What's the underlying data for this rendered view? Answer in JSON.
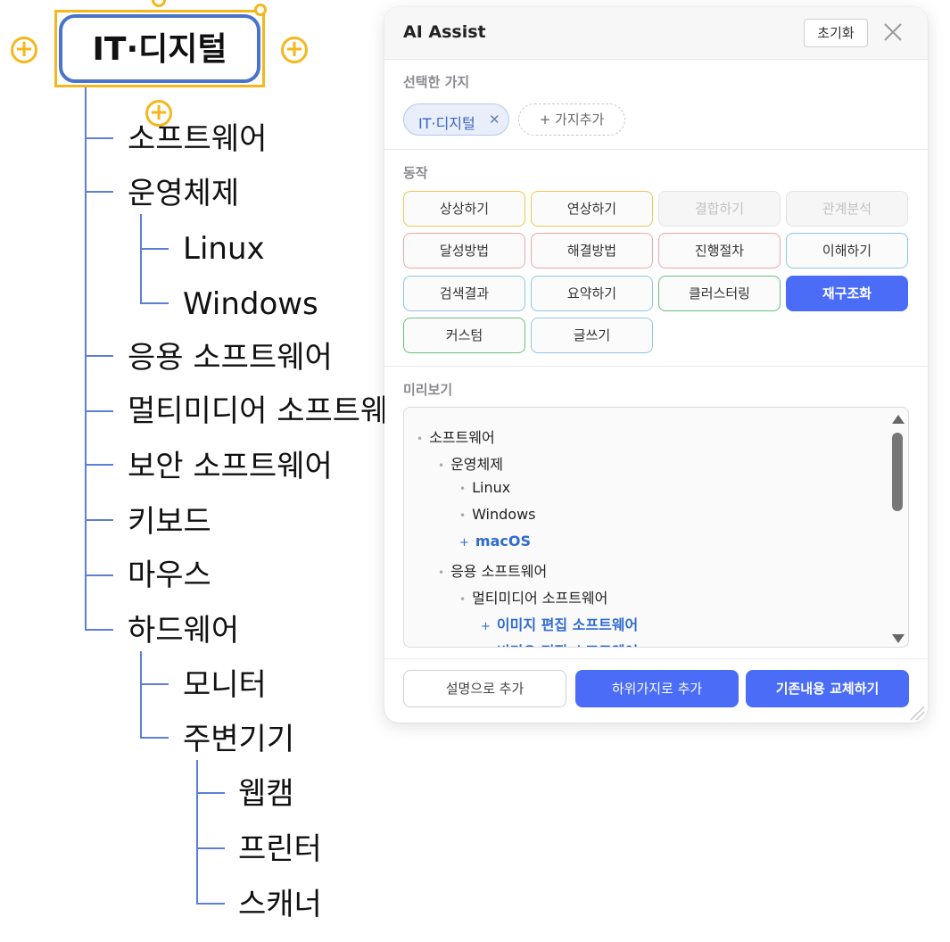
{
  "mindmap": {
    "root": "IT·디지털",
    "nodes": [
      "소프트웨어",
      "운영체제",
      "Linux",
      "Windows",
      "응용 소프트웨어",
      "멀티미디어 소프트웨어",
      "보안 소프트웨어",
      "키보드",
      "마우스",
      "하드웨어",
      "모니터",
      "주변기기",
      "웹캠",
      "프린터",
      "스캐너"
    ]
  },
  "panel": {
    "title": "AI Assist",
    "reset_label": "초기화",
    "selected_section": "선택한 가지",
    "selected_chip": "IT·디지털",
    "add_branch": "+ 가지추가",
    "action_section": "동작",
    "actions": [
      {
        "label": "상상하기",
        "state": "normal",
        "color": "yellow"
      },
      {
        "label": "연상하기",
        "state": "normal",
        "color": "yellow"
      },
      {
        "label": "결합하기",
        "state": "disabled",
        "color": "gray"
      },
      {
        "label": "관계분석",
        "state": "disabled",
        "color": "gray"
      },
      {
        "label": "달성방법",
        "state": "normal",
        "color": "red"
      },
      {
        "label": "해결방법",
        "state": "normal",
        "color": "red"
      },
      {
        "label": "진행절차",
        "state": "normal",
        "color": "red"
      },
      {
        "label": "이해하기",
        "state": "normal",
        "color": "blue"
      },
      {
        "label": "검색결과",
        "state": "normal",
        "color": "blue"
      },
      {
        "label": "요약하기",
        "state": "normal",
        "color": "blue"
      },
      {
        "label": "클러스터링",
        "state": "normal",
        "color": "green"
      },
      {
        "label": "재구조화",
        "state": "active",
        "color": "#4a6cf7"
      },
      {
        "label": "커스텀",
        "state": "normal",
        "color": "green"
      },
      {
        "label": "글쓰기",
        "state": "normal",
        "color": "blue"
      }
    ],
    "preview_section": "미리보기",
    "preview": [
      {
        "text": "소프트웨어",
        "level": 0,
        "new": false
      },
      {
        "text": "운영체제",
        "level": 1,
        "new": false
      },
      {
        "text": "Linux",
        "level": 2,
        "new": false
      },
      {
        "text": "Windows",
        "level": 2,
        "new": false
      },
      {
        "text": "macOS",
        "level": 2,
        "new": true
      },
      {
        "text": "응용 소프트웨어",
        "level": 1,
        "new": false
      },
      {
        "text": "멀티미디어 소프트웨어",
        "level": 2,
        "new": false
      },
      {
        "text": "이미지 편집 소프트웨어",
        "level": 3,
        "new": true
      },
      {
        "text": "비디오 편집 소프트웨어",
        "level": 3,
        "new": true
      }
    ],
    "footer": {
      "add_as_note": "설명으로 추가",
      "add_as_child": "하위가지로 추가",
      "replace": "기존내용 교체하기"
    },
    "colors": {
      "accent": "#4a6cf7",
      "selection": "#f4b81c",
      "root_border": "#4a74c9",
      "new_item": "#2f6bd0"
    }
  }
}
